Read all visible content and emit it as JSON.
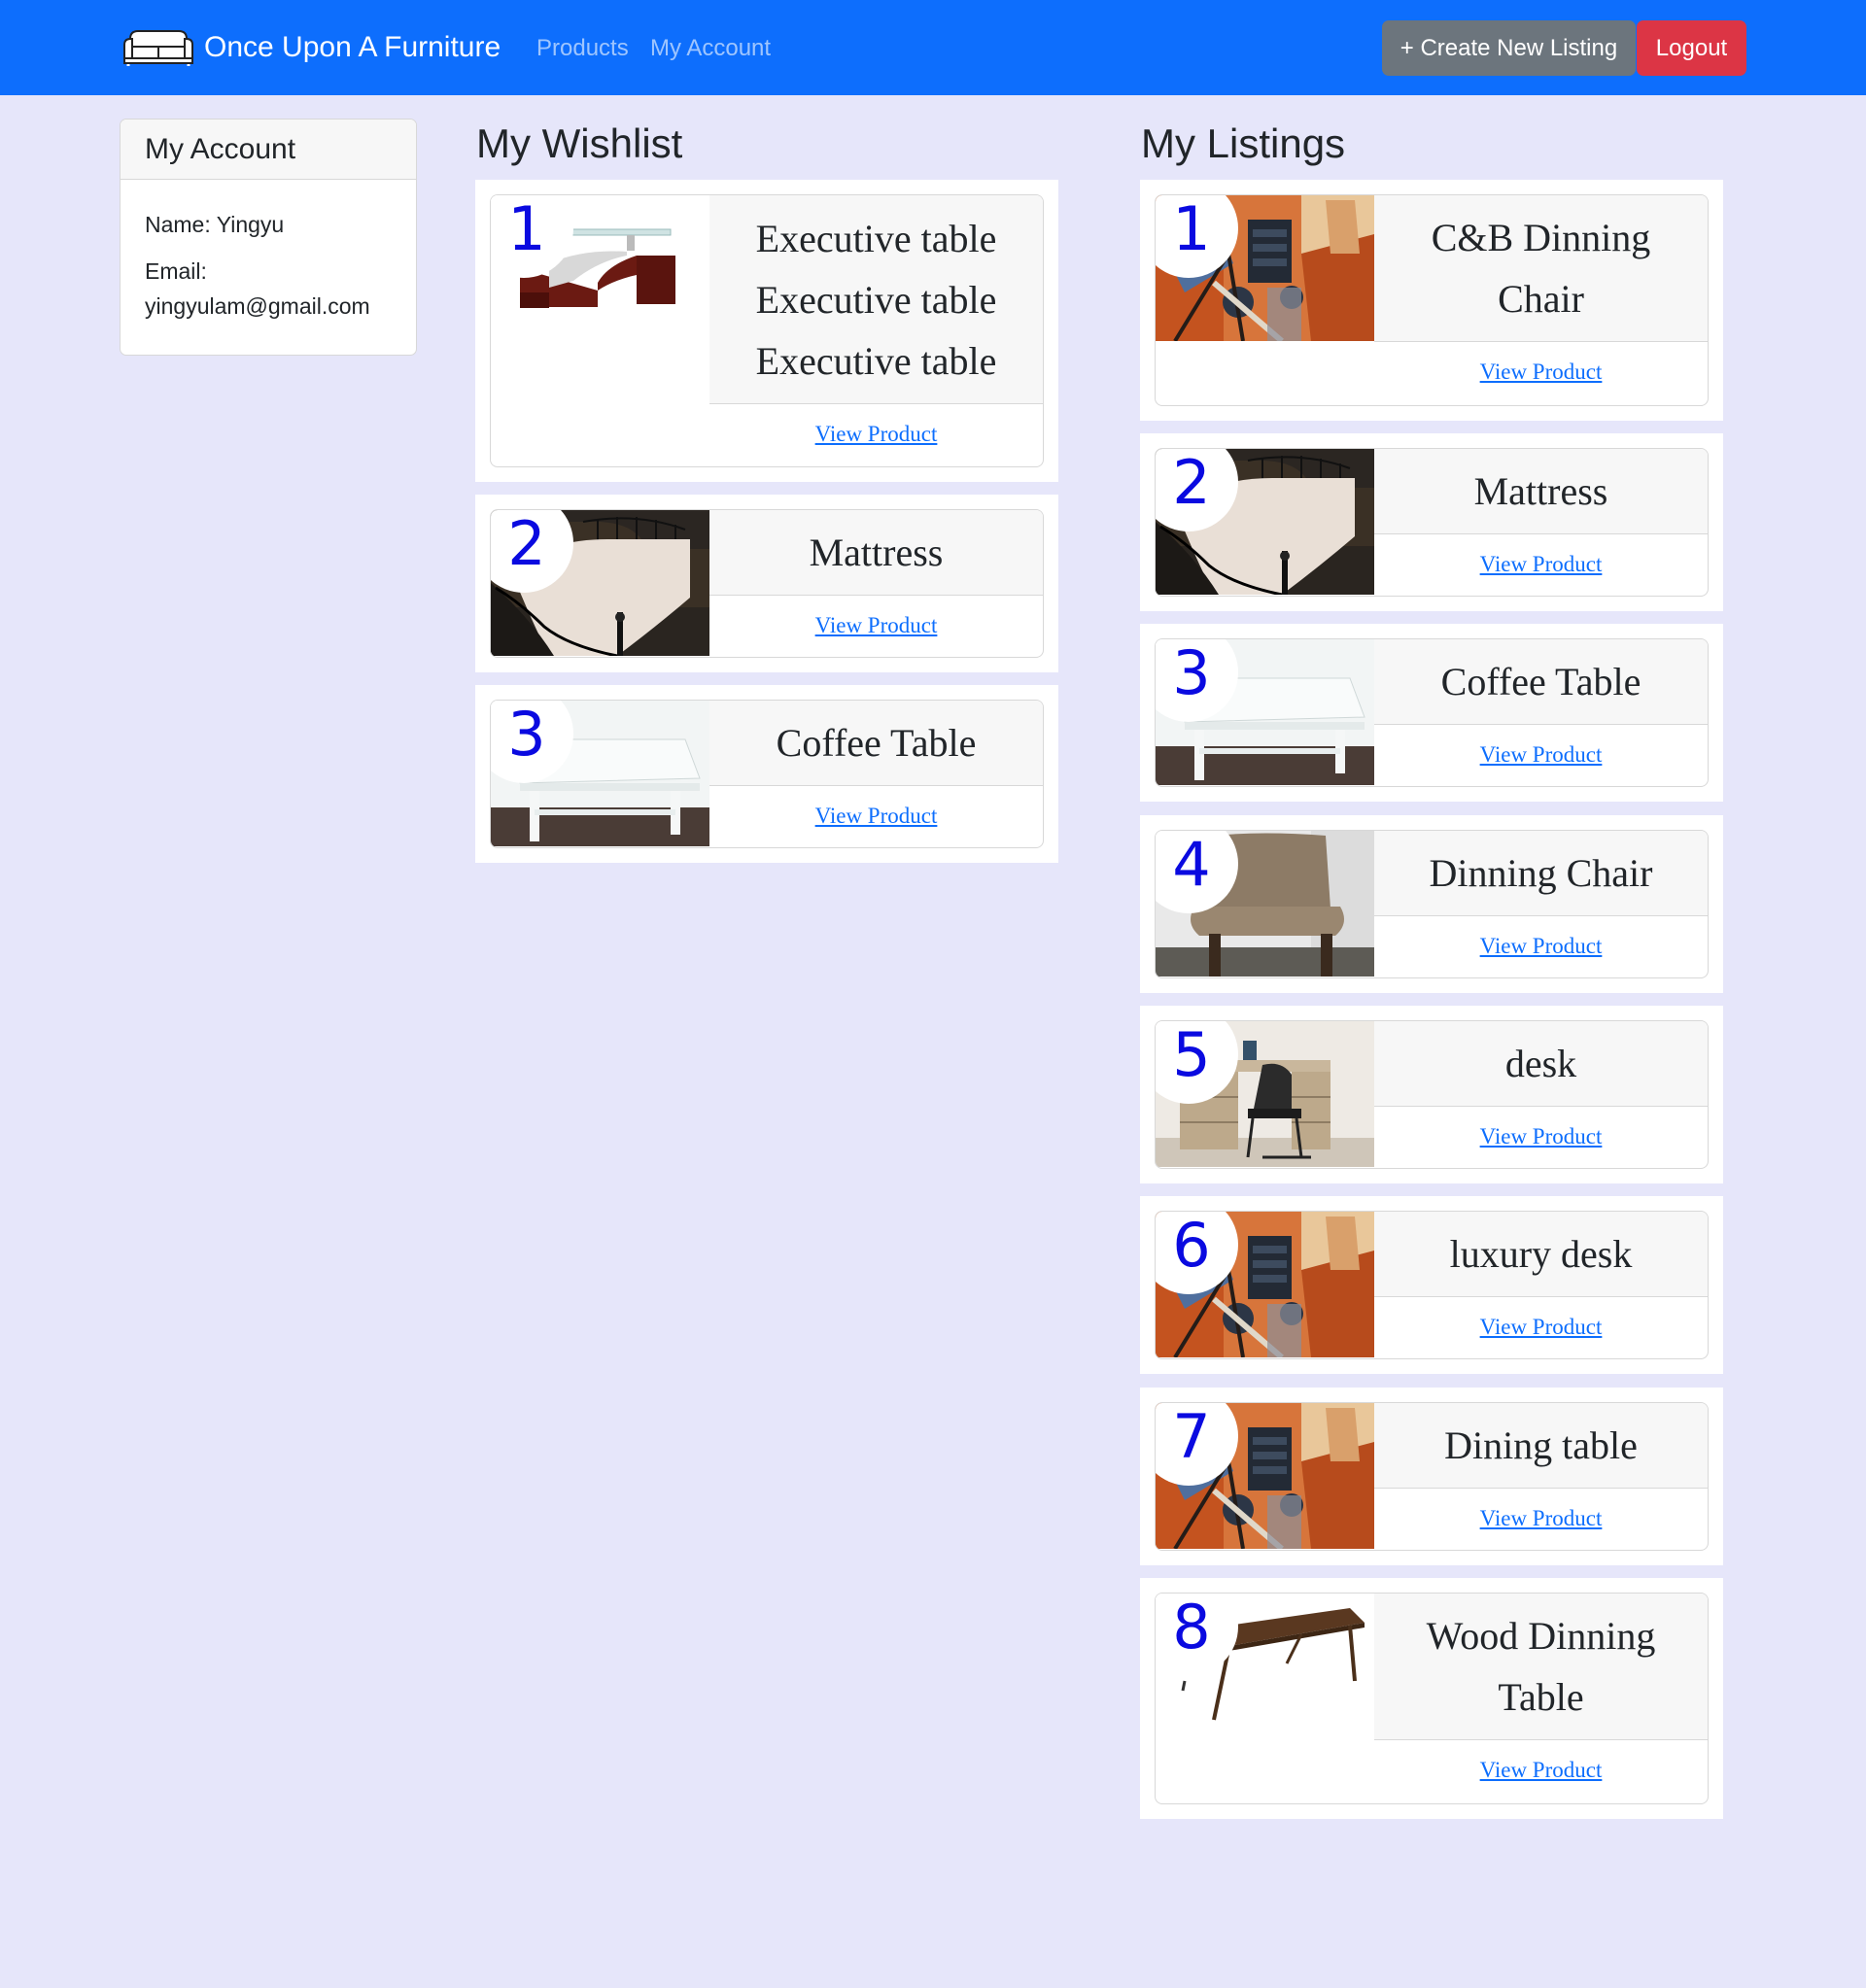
{
  "brand": {
    "name": "Once Upon A Furniture",
    "logo_icon": "sofa-icon"
  },
  "nav": {
    "products": "Products",
    "my_account": "My Account"
  },
  "actions": {
    "create": "+ Create New Listing",
    "logout": "Logout"
  },
  "colors": {
    "navbar": "#0d6efd",
    "create_button": "#6c757d",
    "logout_button": "#dc3545",
    "badge_number": "#0a0ae0",
    "page_bg": "#e6e6fa"
  },
  "account": {
    "title": "My Account",
    "name_line": "Name: Yingyu",
    "email_label": "Email:",
    "email": "yingyulam@gmail.com"
  },
  "wishlist": {
    "title": "My Wishlist",
    "link_label": "View Product",
    "items": [
      {
        "num": "1",
        "title": "Executive table Executive table Executive table",
        "image": "executive-table-photo"
      },
      {
        "num": "2",
        "title": "Mattress",
        "image": "mattress-photo"
      },
      {
        "num": "3",
        "title": "Coffee Table",
        "image": "coffee-table-photo"
      }
    ]
  },
  "listings": {
    "title": "My Listings",
    "link_label": "View Product",
    "items": [
      {
        "num": "1",
        "title": "C&B Dinning Chair",
        "image": "abstract-painting-photo"
      },
      {
        "num": "2",
        "title": "Mattress",
        "image": "mattress-photo"
      },
      {
        "num": "3",
        "title": "Coffee Table",
        "image": "coffee-table-photo"
      },
      {
        "num": "4",
        "title": "Dinning Chair",
        "image": "dining-chair-photo"
      },
      {
        "num": "5",
        "title": "desk",
        "image": "desk-photo"
      },
      {
        "num": "6",
        "title": "luxury desk",
        "image": "abstract-painting-photo"
      },
      {
        "num": "7",
        "title": "Dining table",
        "image": "abstract-painting-photo"
      },
      {
        "num": "8",
        "title": "Wood Dinning Table",
        "image": "wood-table-photo"
      }
    ]
  }
}
